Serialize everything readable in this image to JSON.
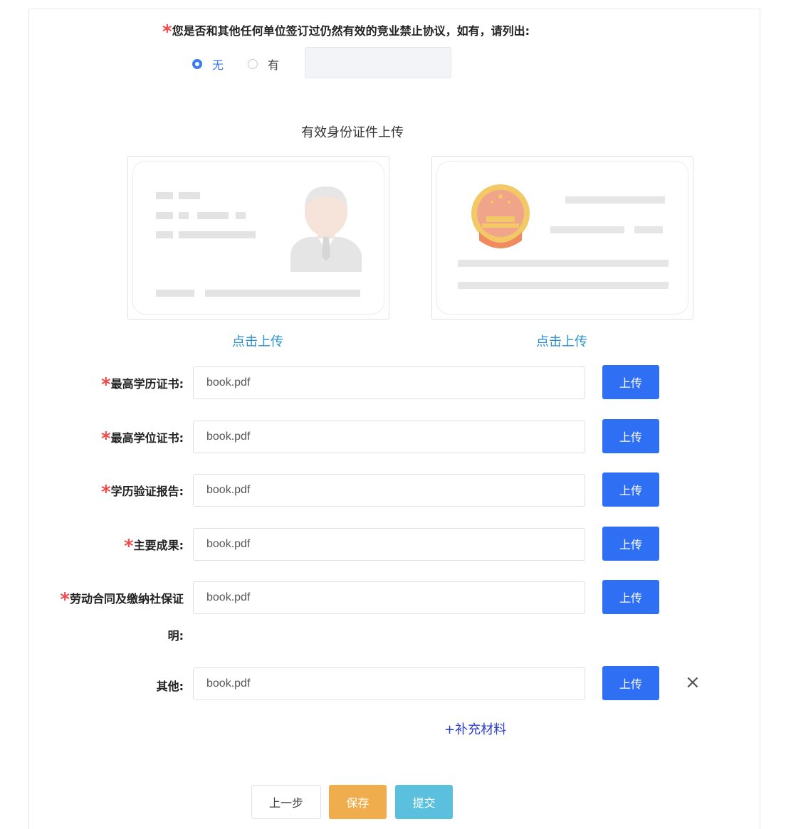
{
  "question": {
    "required_mark": "*",
    "text": "您是否和其他任何单位签订过仍然有效的竞业禁止协议，如有，请列出:",
    "options": [
      {
        "label": "无",
        "checked": true
      },
      {
        "label": "有",
        "checked": false
      }
    ],
    "detail_value": ""
  },
  "id_section": {
    "title": "有效身份证件上传",
    "front_link": "点击上传",
    "back_link": "点击上传"
  },
  "fields": [
    {
      "required_mark": "*",
      "label": "最高学历证书:",
      "value": "book.pdf",
      "button": "上传"
    },
    {
      "required_mark": "*",
      "label": "最高学位证书:",
      "value": "book.pdf",
      "button": "上传"
    },
    {
      "required_mark": "*",
      "label": "学历验证报告:",
      "value": "book.pdf",
      "button": "上传"
    },
    {
      "required_mark": "*",
      "label": "主要成果:",
      "value": "book.pdf",
      "button": "上传"
    },
    {
      "required_mark": "*",
      "label": "劳动合同及缴纳社保证",
      "label_line2": "明:",
      "value": "book.pdf",
      "button": "上传"
    },
    {
      "label": "其他:",
      "value": "book.pdf",
      "button": "上传",
      "remove": "×"
    }
  ],
  "add_more": "+补充材料",
  "actions": {
    "prev": "上一步",
    "save": "保存",
    "submit": "提交"
  },
  "colors": {
    "primary": "#2f6ff3",
    "required": "#f04b4b",
    "link": "#2a8fd0",
    "save": "#f0ad4e",
    "submit": "#5bc0de"
  }
}
